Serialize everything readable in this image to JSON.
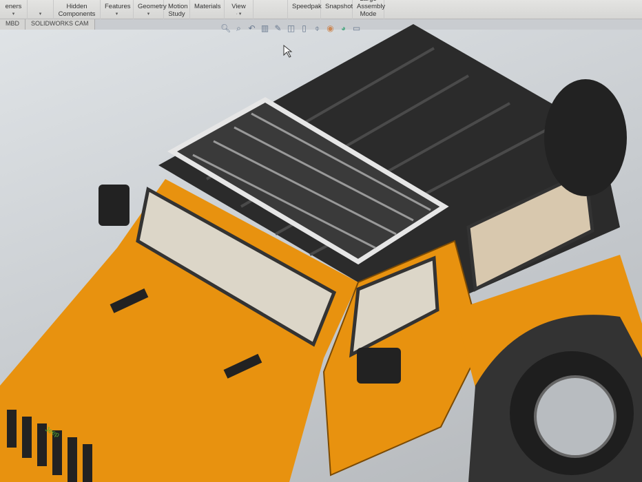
{
  "ribbon": {
    "items": [
      {
        "label": "eners",
        "dropdown": false
      },
      {
        "label": "",
        "dropdown": true
      },
      {
        "label": "Hidden Components",
        "dropdown": false
      },
      {
        "label": "Features",
        "dropdown": true
      },
      {
        "label": "Geometry",
        "dropdown": true
      },
      {
        "label": "Motion Study",
        "dropdown": false
      },
      {
        "label": "Materials",
        "dropdown": false
      },
      {
        "label": "View",
        "dropdown": true
      },
      {
        "label": "",
        "dropdown": false
      },
      {
        "label": "Speedpak",
        "dropdown": false
      },
      {
        "label": "Snapshot",
        "dropdown": false
      },
      {
        "label": "Large Assembly Mode",
        "dropdown": false
      }
    ]
  },
  "tabs": [
    "MBD",
    "SOLIDWORKS CAM"
  ],
  "heads_up_toolbar": [
    "zoom-to-fit-icon",
    "zoom-to-area-icon",
    "previous-view-icon",
    "section-view-icon",
    "dynamic-annotation-icon",
    "view-orientation-icon",
    "display-style-icon",
    "hide-show-icon",
    "edit-appearance-icon",
    "scene-icon",
    "view-settings-icon"
  ],
  "model": {
    "grille_badge": "Jeep",
    "body_color": "#e8920f",
    "roof_color": "#2b2b2b"
  }
}
